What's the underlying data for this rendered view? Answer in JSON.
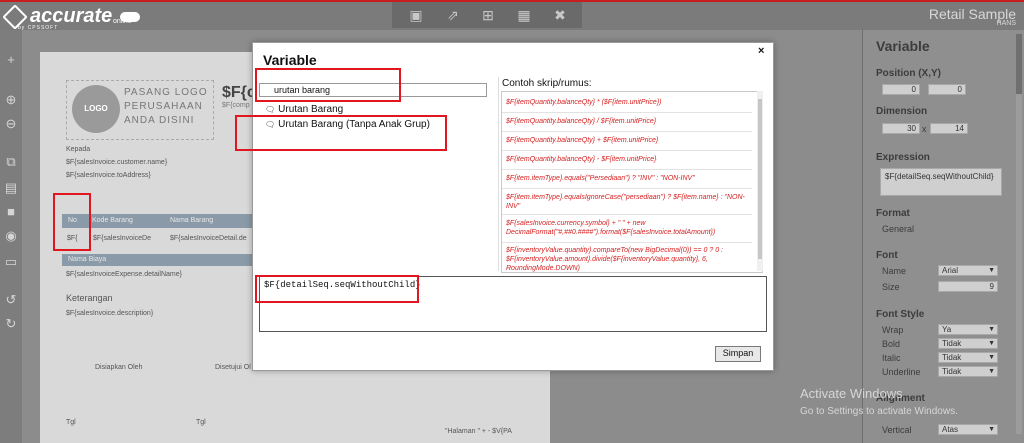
{
  "app": {
    "brand": "accurate",
    "brand_sub": "by CPSSOFT",
    "brand_online": "online",
    "title": "Retail Sample",
    "subtitle": "HANS"
  },
  "toolbar_icons": [
    "camera-icon",
    "export-icon",
    "add-icon",
    "store-icon",
    "close-icon"
  ],
  "left_toolbar_icons": [
    "add-icon",
    "zoom-in-icon",
    "zoom-out-icon",
    "copy-icon",
    "paste-icon",
    "cut-icon",
    "format-icon",
    "delete-icon",
    "undo-icon",
    "redo-icon"
  ],
  "paper": {
    "logo": "LOGO",
    "logo_text_lines": [
      "PASANG LOGO",
      "PERUSAHAAN",
      "ANDA DISINI"
    ],
    "company_var": "$F{c",
    "company_sub": "$F{comp",
    "kepada_label": "Kepada",
    "customer_name": "$F{salesInvoice.customer.name}",
    "to_address": "$F{salesInvoice.toAddress}",
    "table_headers": [
      "No",
      "Kode Barang",
      "Nama Barang"
    ],
    "detail_cells": [
      "$F{",
      "$F{salesInvoiceDe",
      "$F{salesInvoiceDetail.de"
    ],
    "biaya_header": "Nama Biaya",
    "expense_detail": "$F{salesInvoiceExpense.detailName}",
    "keterangan_label": "Keterangan",
    "description": "$F{salesInvoice.description}",
    "disiapkan": "Disiapkan Oleh",
    "disetujui": "Disetujui Ol",
    "tgl1": "Tgl",
    "tgl2": "Tgl",
    "halaman": "\"Halaman \" + - $V{PA"
  },
  "right_panel": {
    "header": "Variable",
    "position_label": "Position (X,Y)",
    "pos_x": "0",
    "pos_y": "0",
    "dimension_label": "Dimension",
    "dim_w": "30",
    "dim_h": "14",
    "dim_sep": "x",
    "expression_label": "Expression",
    "expression_value": "$F{detailSeq.seqWithoutChild}",
    "format_label": "Format",
    "format_value": "General",
    "font_label": "Font",
    "name_label": "Name",
    "name_value": "Arial",
    "size_label": "Size",
    "size_value": "9",
    "font_style_label": "Font Style",
    "wrap_label": "Wrap",
    "wrap_value": "Ya",
    "bold_label": "Bold",
    "bold_value": "Tidak",
    "italic_label": "Italic",
    "italic_value": "Tidak",
    "underline_label": "Underline",
    "underline_value": "Tidak",
    "alignment_label": "Alignment",
    "vertical_label": "Vertical",
    "vertical_value": "Atas"
  },
  "watermark": {
    "line1": "Activate Windows",
    "line2": "Go to Settings to activate Windows."
  },
  "modal": {
    "title": "Variable",
    "close": "×",
    "search_value": "urutan barang",
    "items": [
      "Urutan Barang",
      "Urutan Barang (Tanpa Anak Grup)"
    ],
    "examples_title": "Contoh skrip/rumus:",
    "examples": [
      "$F{itemQuantity.balanceQty} * ($F{item.unitPrice})",
      "$F{itemQuantity.balanceQty} / $F{item.unitPrice}",
      "$F{itemQuantity.balanceQty} + $F{item.unitPrice}",
      "$F{itemQuantity.balanceQty} - $F{item.unitPrice}",
      "$F{item.itemType}.equals(\"Persediaan\") ? \"INV\" : \"NON-INV\"",
      "$F{item.itemType}.equalsIgnoreCase(\"persediaan\") ? $F{item.name} : \"NON-INV\"",
      "$F{salesInvoice.currency.symbol} + \" \" + new DecimalFormat(\"#,##0.####\").format($F{salesInvoice.totalAmount})",
      "$F{inventoryValue.quantity}.compareTo(new BigDecimal(0)) == 0 ? 0 : $F{inventoryValue.amount}.divide($F{inventoryValue.quantity}, 6, RoundingMode.DOWN)"
    ],
    "editor_value": "$F{detailSeq.seqWithoutChild}",
    "save_label": "Simpan"
  },
  "colors": {
    "accent_red": "#e2161e",
    "example_text": "#d62020"
  }
}
